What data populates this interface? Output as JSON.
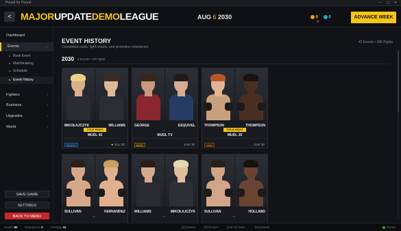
{
  "window": {
    "title": "Pound for Pound",
    "controls": [
      "—",
      "▢",
      "✕"
    ]
  },
  "header": {
    "back_label": "<",
    "brand": {
      "major": "MAJOR",
      "update": "UPDATE",
      "demo": "DEMO",
      "league": "LEAGUE"
    },
    "date": {
      "month": "AUG",
      "sep": "6",
      "year": "2030"
    },
    "currency_gold": "0",
    "currency_gold_delta": "-0",
    "currency_cyan": "0",
    "advance_label": "ADVANCE WEEK"
  },
  "sidebar": {
    "dashboard": "Dashboard",
    "events": "Events",
    "sub": [
      "Book Event",
      "Matchmaking",
      "Schedule",
      "Event History"
    ],
    "fighters": "Fighters",
    "business": "Business",
    "upgrades": "Upgrades",
    "world": "World",
    "save": "SAVE GAME",
    "settings": "SETTINGS",
    "menu": "BACK TO MENU"
  },
  "main": {
    "title": "EVENT HISTORY",
    "subtitle": "Completed cards, fight results, and promotion milestones.",
    "counts": "42 Events • 285 Fights",
    "year": "2030",
    "year_summary": "8 Events • 18 Fights",
    "vs": "vs"
  },
  "cards": [
    {
      "f1": "MIKOŁAJCZYK",
      "f2": "WILLIAMS",
      "tag": "TITLE FIGHT",
      "promo": "MUDL 42",
      "badge": "RECENT",
      "star": "★",
      "date": "JUL '30"
    },
    {
      "f1": "GEORGE",
      "f2": "ESQUIVEL",
      "tag": "",
      "promo": "MUDL TV",
      "badge": "MUDL",
      "star": "",
      "date": "JUN '30"
    },
    {
      "f1": "THOMPSON",
      "f2": "THOMPSON",
      "tag": "TITLE FIGHT",
      "promo": "MUDL 39",
      "badge": "HIGH",
      "star": "",
      "date": "JUN '30"
    },
    {
      "f1": "SULLIVAN",
      "f2": "FERNANDEZ",
      "tag": "",
      "promo": "",
      "badge": "",
      "star": "",
      "date": ""
    },
    {
      "f1": "WILLIAMS",
      "f2": "MIKOŁAJCZYK",
      "tag": "",
      "promo": "",
      "badge": "",
      "star": "",
      "date": ""
    },
    {
      "f1": "SULLIVAN",
      "f2": "HOLLAND",
      "tag": "",
      "promo": "",
      "badge": "",
      "star": "",
      "date": ""
    }
  ],
  "status": {
    "roster_label": "Roster",
    "roster": "80",
    "champions_label": "Champions",
    "champions": "3",
    "prestige_label": "Prestige",
    "prestige": "41",
    "k1": "[E] Events",
    "k2": "[R] Roster",
    "k3": "[Ctrl+S] Save",
    "k4": "[Esc] Back",
    "saved": "Saved"
  },
  "colors": {
    "accent": "#f5c518",
    "danger": "#c6262d",
    "bg": "#0d0e11"
  }
}
